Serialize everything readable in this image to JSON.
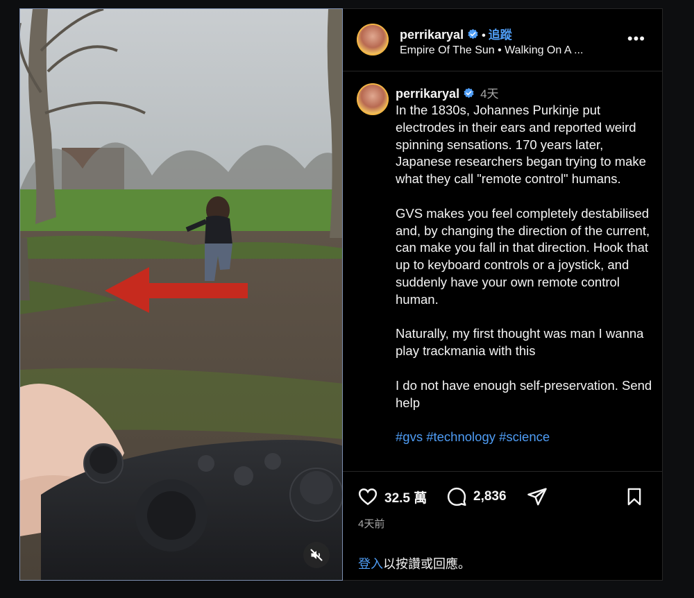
{
  "video": {
    "muted": true,
    "overlay_arrow_direction": "left",
    "overlay_arrow_color": "#c62a1e"
  },
  "post": {
    "username": "perrikaryal",
    "verified": true,
    "follow_label": "追蹤",
    "separator": "•",
    "audio": {
      "artist": "Empire Of The Sun",
      "separator": "•",
      "track": "Walking On A ..."
    },
    "more_label": "•••"
  },
  "caption": {
    "username": "perrikaryal",
    "time": "4天",
    "paragraphs": [
      "In the 1830s, Johannes Purkinje put electrodes in their ears and reported weird spinning sensations. 170 years later, Japanese researchers began trying to make what they call \"remote control\" humans.",
      "GVS makes you feel completely destabilised and, by changing the direction of the current, can make you fall in that direction. Hook that up to keyboard controls or a joystick, and suddenly have your own remote control human.",
      "Naturally, my first thought was man I wanna play trackmania with this",
      "I do not have enough self-preservation. Send help"
    ],
    "hashtags": "#gvs #technology #science"
  },
  "actions": {
    "likes": "32.5 萬",
    "comments": "2,836"
  },
  "date": "4天前",
  "login_prompt": {
    "link": "登入",
    "text": "以按讚或回應。"
  },
  "colors": {
    "accent": "#4f9df5",
    "background": "#000000",
    "secondary_text": "#a8a8a8"
  }
}
